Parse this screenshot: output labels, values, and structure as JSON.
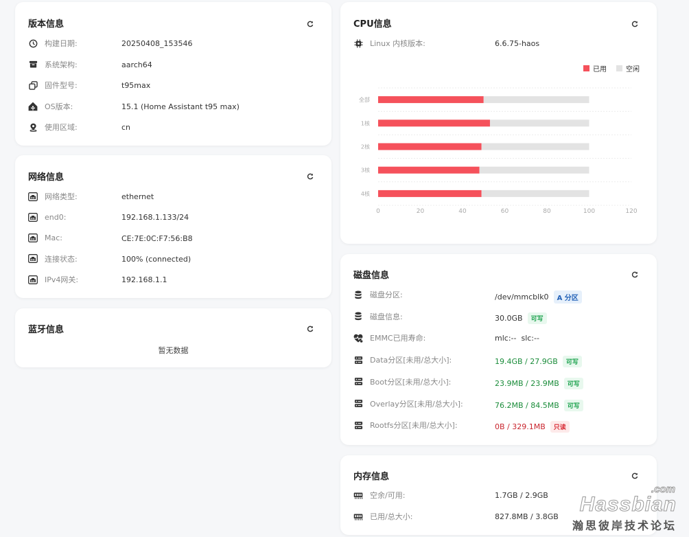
{
  "version": {
    "title": "版本信息",
    "rows": [
      {
        "icon": "clock-icon",
        "label": "构建日期:",
        "value": "20250408_153546"
      },
      {
        "icon": "box-icon",
        "label": "系统架构:",
        "value": "aarch64"
      },
      {
        "icon": "copy-icon",
        "label": "固件型号:",
        "value": "t95max"
      },
      {
        "icon": "home-assistant-icon",
        "label": "OS版本:",
        "value": "15.1 (Home Assistant t95 max)"
      },
      {
        "icon": "location-pin-icon",
        "label": "使用区域:",
        "value": "cn"
      }
    ]
  },
  "network": {
    "title": "网络信息",
    "rows": [
      {
        "icon": "ethernet-icon",
        "label": "网络类型:",
        "value": "ethernet"
      },
      {
        "icon": "ethernet-icon",
        "label": "end0:",
        "value": "192.168.1.133/24"
      },
      {
        "icon": "ethernet-icon",
        "label": "Mac:",
        "value": "CE:7E:0C:F7:56:B8"
      },
      {
        "icon": "ethernet-icon",
        "label": "连接状态:",
        "value": "100% (connected)"
      },
      {
        "icon": "ethernet-icon",
        "label": "IPv4网关:",
        "value": "192.168.1.1"
      }
    ]
  },
  "bluetooth": {
    "title": "蓝牙信息",
    "empty_text": "暂无数据"
  },
  "cpu": {
    "title": "CPU信息",
    "kernel_label": "Linux 内核版本:",
    "kernel_value": "6.6.75-haos",
    "legend_used": "已用",
    "legend_idle": "空闲",
    "colors": {
      "used": "#f5515b",
      "idle": "#e3e3e3"
    }
  },
  "chart_data": {
    "type": "bar",
    "orientation": "horizontal",
    "stacked": true,
    "categories": [
      "全部",
      "1核",
      "2核",
      "3核",
      "4核"
    ],
    "series": [
      {
        "name": "已用",
        "values": [
          50,
          53,
          49,
          48,
          49
        ]
      },
      {
        "name": "空闲",
        "values": [
          50,
          47,
          51,
          52,
          51
        ]
      }
    ],
    "xticks": [
      "0",
      "20",
      "40",
      "60",
      "80",
      "100",
      "120"
    ],
    "xlim": [
      0,
      120
    ],
    "grid": true,
    "legend": "top-right"
  },
  "disk": {
    "title": "磁盘信息",
    "rows": [
      {
        "icon": "database-icon",
        "label": "磁盘分区:",
        "value": "/dev/mmcblk0",
        "value_color": "",
        "badge": "A 分区",
        "badge_type": "blue"
      },
      {
        "icon": "database-icon",
        "label": "磁盘信息:",
        "value": "30.0GB",
        "value_color": "",
        "badge": "可写",
        "badge_type": "green"
      },
      {
        "icon": "heart-pulse-icon",
        "label": "EMMC已用寿命:",
        "value": "mlc:--  slc:--",
        "value_color": "",
        "badge": "",
        "badge_type": ""
      },
      {
        "icon": "server-icon",
        "label": "Data分区[未用/总大小]:",
        "value": "19.4GB / 27.9GB",
        "value_color": "green",
        "badge": "可写",
        "badge_type": "green"
      },
      {
        "icon": "server-icon",
        "label": "Boot分区[未用/总大小]:",
        "value": "23.9MB / 23.9MB",
        "value_color": "green",
        "badge": "可写",
        "badge_type": "green"
      },
      {
        "icon": "server-icon",
        "label": "Overlay分区[未用/总大小]:",
        "value": "76.2MB / 84.5MB",
        "value_color": "green",
        "badge": "可写",
        "badge_type": "green"
      },
      {
        "icon": "server-icon",
        "label": "Rootfs分区[未用/总大小]:",
        "value": "0B / 329.1MB",
        "value_color": "red",
        "badge": "只读",
        "badge_type": "red"
      }
    ]
  },
  "memory": {
    "title": "内存信息",
    "rows": [
      {
        "icon": "memory-icon",
        "label": "空余/可用:",
        "value": "1.7GB / 2.9GB"
      },
      {
        "icon": "memory-icon",
        "label": "已用/总大小:",
        "value": "827.8MB / 3.8GB"
      }
    ]
  },
  "watermark": {
    "brand": "Hassbian",
    "domain": ".com",
    "subtitle": "瀚思彼岸技术论坛"
  }
}
